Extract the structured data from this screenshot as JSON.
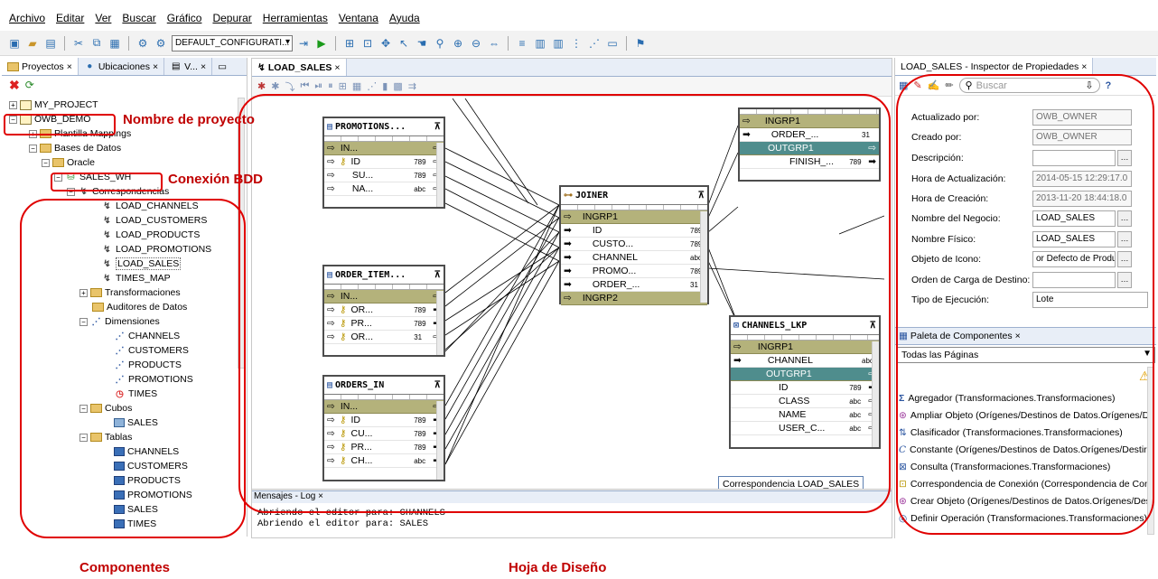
{
  "menu": [
    "Archivo",
    "Editar",
    "Ver",
    "Buscar",
    "Gráfico",
    "Depurar",
    "Herramientas",
    "Ventana",
    "Ayuda"
  ],
  "toolbar": {
    "config_combo": "DEFAULT_CONFIGURATI..."
  },
  "left_tabs": [
    "Proyectos",
    "Ubicaciones",
    "V..."
  ],
  "tree": {
    "my_project": "MY_PROJECT",
    "owb_demo": "OWB_DEMO",
    "plantilla": "Plantilla Mappings",
    "bases_datos": "Bases de Datos",
    "oracle": "Oracle",
    "sales_wh": "SALES_WH",
    "correspondencias": "Correspondencias",
    "mappings": [
      "LOAD_CHANNELS",
      "LOAD_CUSTOMERS",
      "LOAD_PRODUCTS",
      "LOAD_PROMOTIONS",
      "LOAD_SALES",
      "TIMES_MAP"
    ],
    "transformaciones": "Transformaciones",
    "auditores": "Auditores de Datos",
    "dimensiones": "Dimensiones",
    "dims": [
      "CHANNELS",
      "CUSTOMERS",
      "PRODUCTS",
      "PROMOTIONS",
      "TIMES"
    ],
    "cubos": "Cubos",
    "cubes": [
      "SALES"
    ],
    "tablas": "Tablas",
    "tables": [
      "CHANNELS",
      "CUSTOMERS",
      "PRODUCTS",
      "PROMOTIONS",
      "SALES",
      "TIMES"
    ]
  },
  "editor": {
    "tab": "LOAD_SALES",
    "promotions": {
      "title": "PROMOTIONS...",
      "group": "IN...",
      "rows": [
        [
          "ID",
          "789"
        ],
        [
          "SU...",
          "789"
        ],
        [
          "NA...",
          "abc"
        ]
      ]
    },
    "order_items": {
      "title": "ORDER_ITEM...",
      "group": "IN...",
      "rows": [
        [
          "OR...",
          "789"
        ],
        [
          "PR...",
          "789"
        ],
        [
          "OR...",
          "31"
        ]
      ]
    },
    "orders_in": {
      "title": "ORDERS_IN",
      "group": "IN...",
      "rows": [
        [
          "ID",
          "789"
        ],
        [
          "CU...",
          "789"
        ],
        [
          "PR...",
          "789"
        ],
        [
          "CH...",
          "abc"
        ]
      ]
    },
    "joiner": {
      "title": "JOINER",
      "group": "INGRP1",
      "rows": [
        [
          "ID",
          "789"
        ],
        [
          "CUSTO...",
          "789"
        ],
        [
          "CHANNEL",
          "abc"
        ],
        [
          "PROMO...",
          "789"
        ],
        [
          "ORDER_...",
          "31"
        ]
      ],
      "group2": "INGRP2"
    },
    "top_right": {
      "group": "INGRP1",
      "row": [
        "ORDER_...",
        "31"
      ],
      "out": "OUTGRP1",
      "row2": [
        "FINISH_...",
        "789"
      ]
    },
    "channels_lkp": {
      "title": "CHANNELS_LKP",
      "group": "INGRP1",
      "in_row": [
        "CHANNEL",
        "abc"
      ],
      "out": "OUTGRP1",
      "rows": [
        [
          "ID",
          "789"
        ],
        [
          "CLASS",
          "abc"
        ],
        [
          "NAME",
          "abc"
        ],
        [
          "USER_C...",
          "abc"
        ]
      ]
    },
    "corr_label": "Correspondencia LOAD_SALES"
  },
  "log": {
    "tab": "Mensajes - Log",
    "lines": [
      "Abriendo el editor para: CHANNELS",
      "Abriendo el editor para: SALES"
    ]
  },
  "inspector": {
    "title": "LOAD_SALES - Inspector de Propiedades",
    "search_placeholder": "Buscar",
    "props": [
      {
        "label": "Actualizado por:",
        "value": "OWB_OWNER"
      },
      {
        "label": "Creado por:",
        "value": "OWB_OWNER"
      },
      {
        "label": "Descripción:",
        "value": ""
      },
      {
        "label": "Hora de Actualización:",
        "value": "2014-05-15 12:29:17.0"
      },
      {
        "label": "Hora de Creación:",
        "value": "2013-11-20 18:44:18.0"
      },
      {
        "label": "Nombre del Negocio:",
        "value": "LOAD_SALES"
      },
      {
        "label": "Nombre Físico:",
        "value": "LOAD_SALES"
      },
      {
        "label": "Objeto de Icono:",
        "value": "or Defecto de Producto"
      },
      {
        "label": "Orden de Carga de Destino:",
        "value": ""
      },
      {
        "label": "Tipo de Ejecución:",
        "value": "Lote"
      }
    ]
  },
  "palette": {
    "title": "Paleta de Componentes",
    "filter": "Todas las Páginas",
    "items": [
      "Agregador (Transformaciones.Transformaciones)",
      "Ampliar Objeto (Orígenes/Destinos de Datos.Orígenes/De",
      "Clasificador (Transformaciones.Transformaciones)",
      "Constante (Orígenes/Destinos de Datos.Orígenes/Destir",
      "Consulta (Transformaciones.Transformaciones)",
      "Correspondencia de Conexión (Correspondencia de Cone",
      "Crear Objeto (Orígenes/Destinos de Datos.Orígenes/Des",
      "Definir Operación (Transformaciones.Transformaciones)"
    ]
  },
  "annotations": {
    "nombre_proyecto": "Nombre de proyecto",
    "conexion_bdd": "Conexión BDD",
    "componentes": "Componentes",
    "hoja_diseno": "Hoja de Diseño"
  }
}
